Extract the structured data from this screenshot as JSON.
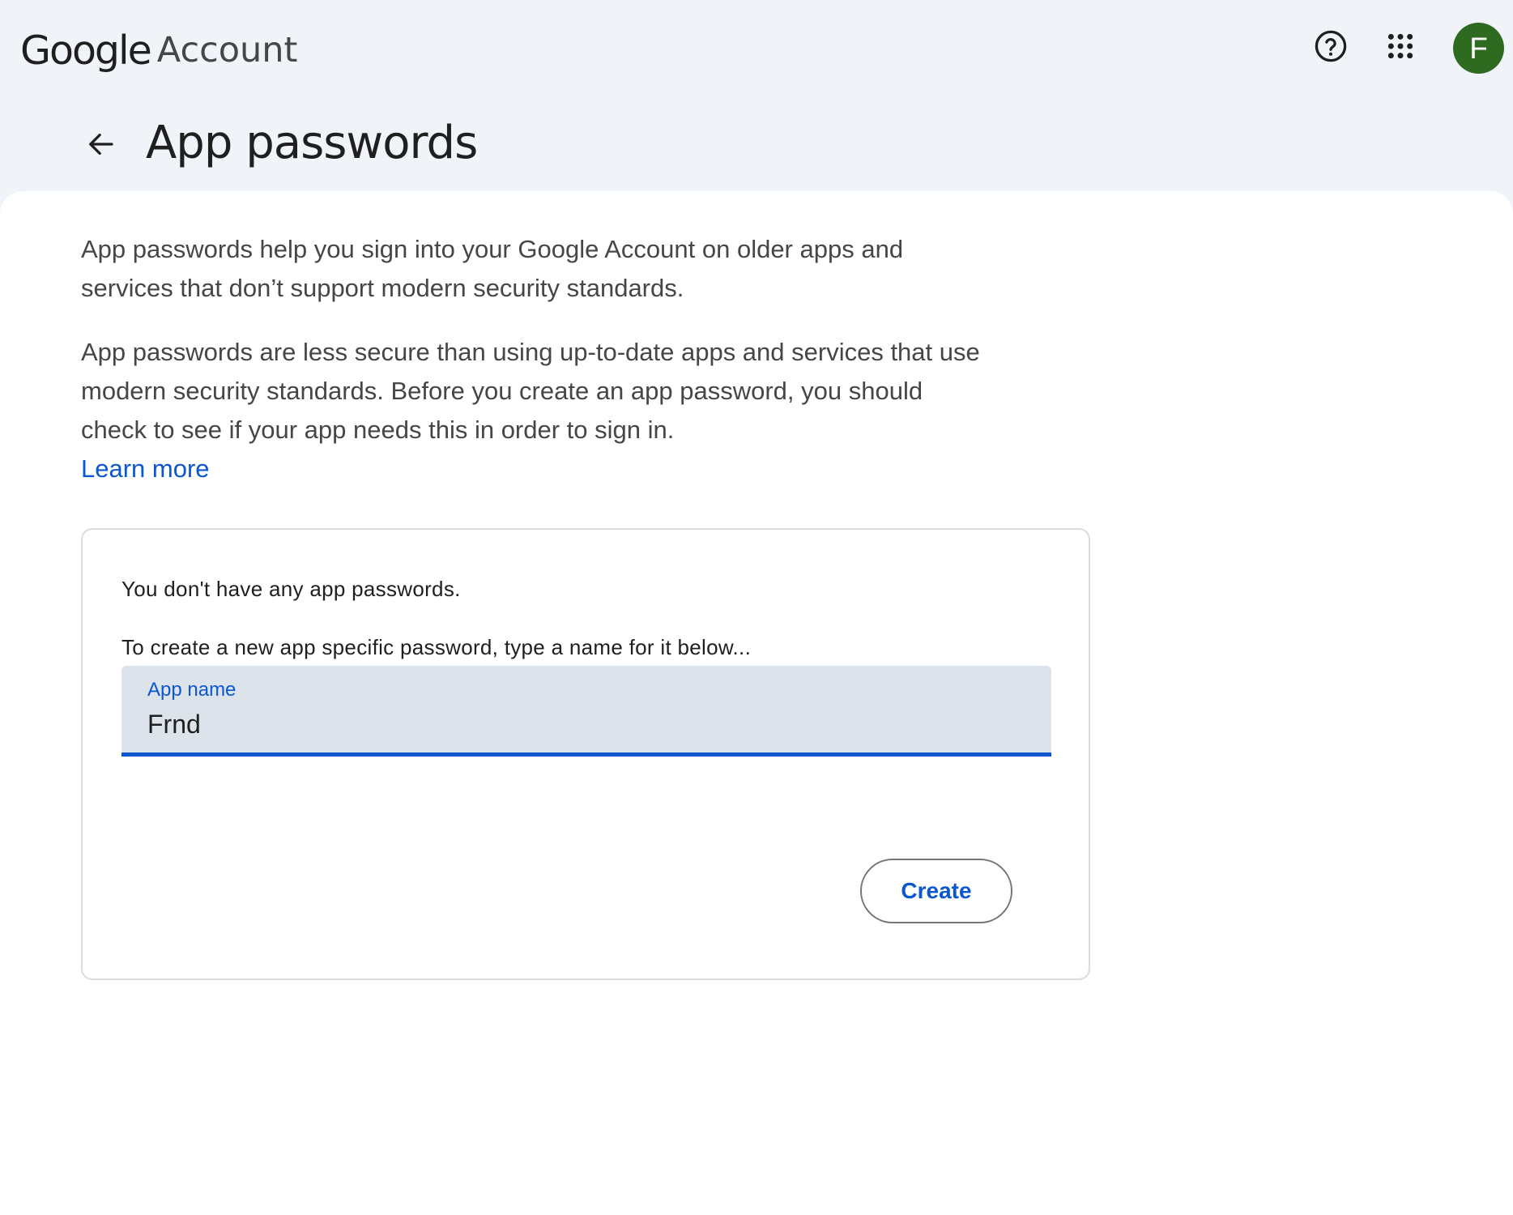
{
  "header": {
    "logo_google": "Google",
    "logo_account": "Account",
    "help_icon": "help-circle-icon",
    "apps_icon": "apps-grid-icon",
    "avatar_initial": "F",
    "avatar_color": "#2e6b20"
  },
  "page": {
    "back_icon": "arrow-back-icon",
    "title": "App passwords"
  },
  "intro": {
    "paragraph1": "App passwords help you sign into your Google Account on older apps and services that don’t support modern security standards.",
    "paragraph2": "App passwords are less secure than using up-to-date apps and services that use modern security standards. Before you create an app password, you should check to see if your app needs this in order to sign in.",
    "learn_more": "Learn more"
  },
  "card": {
    "no_passwords": "You don't have any app passwords.",
    "create_hint": "To create a new app specific password, type a name for it below...",
    "field_label": "App name",
    "field_value": "Frnd",
    "create_label": "Create"
  },
  "colors": {
    "accent": "#0b57d0",
    "header_bg": "#f0f4f9",
    "field_bg": "#dde3ea"
  }
}
